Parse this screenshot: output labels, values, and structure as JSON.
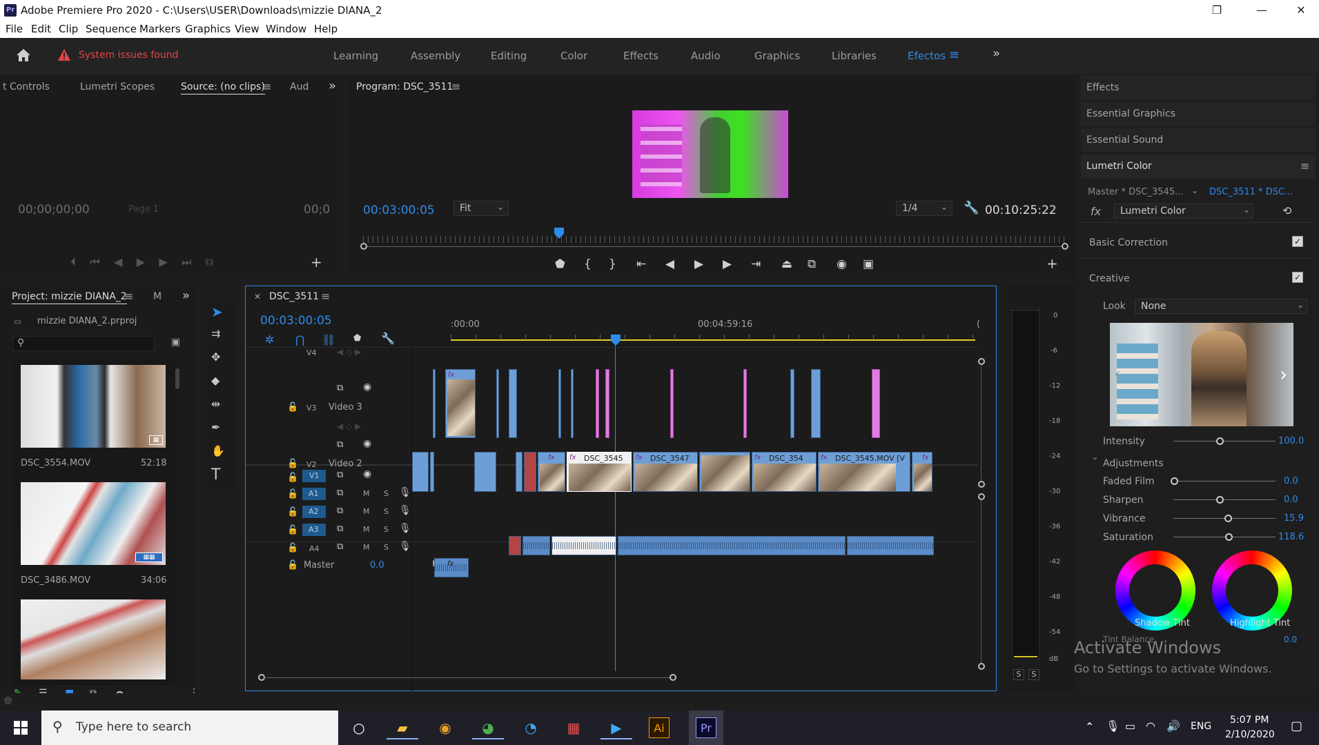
{
  "titlebar": {
    "app_icon_text": "Pr",
    "title": "Adobe Premiere Pro 2020 - C:\\Users\\USER\\Downloads\\mizzie DIANA_2",
    "minimize": "—",
    "maximize": "❐",
    "close": "✕"
  },
  "menu": [
    "File",
    "Edit",
    "Clip",
    "Sequence",
    "Markers",
    "Graphics",
    "View",
    "Window",
    "Help"
  ],
  "workspace": {
    "alert": "System issues found",
    "tabs": [
      "Learning",
      "Assembly",
      "Editing",
      "Color",
      "Effects",
      "Audio",
      "Graphics",
      "Libraries",
      "Efectos"
    ],
    "active": "Efectos"
  },
  "source_panel": {
    "tabs": [
      "t Controls",
      "Lumetri Scopes",
      "Source: (no clips)",
      "Aud"
    ],
    "timecode_left": "00;00;00;00",
    "page": "Page 1",
    "timecode_right": "00;0"
  },
  "program_panel": {
    "title": "Program: DSC_3511",
    "timecode": "00:03:00:05",
    "fit": "Fit",
    "resolution": "1/4",
    "duration": "00:10:25:22"
  },
  "project_panel": {
    "title": "Project: mizzie DIANA_2",
    "tab2": "M",
    "file": "mizzie DIANA_2.prproj",
    "items": [
      {
        "name": "DSC_3554.MOV",
        "duration": "52:18"
      },
      {
        "name": "DSC_3486.MOV",
        "duration": "34:06"
      }
    ]
  },
  "timeline": {
    "sequence": "DSC_3511",
    "timecode": "00:03:00:05",
    "ruler_start": ":00:00",
    "ruler_mid": "00:04:59:16",
    "ruler_end": "(",
    "tracks": {
      "v4": "V4",
      "v3": "V3",
      "v3_name": "Video 3",
      "v2": "V2",
      "v2_name": "Video 2",
      "v1": "V1",
      "a1": "A1",
      "a2": "A2",
      "a3": "A3",
      "a4": "A4",
      "master": "Master",
      "master_val": "0.0",
      "m": "M",
      "s": "S"
    },
    "clips_v2": [
      "DSC_3545",
      "DSC_3547",
      "DSC_354",
      "DSC_3545.MOV [V"
    ],
    "fx": "fx"
  },
  "audio_meter": {
    "scale": [
      "0",
      "-6",
      "-12",
      "-18",
      "-24",
      "-30",
      "-36",
      "-42",
      "-48",
      "-54",
      "dB"
    ],
    "solo": "S"
  },
  "right_panel": {
    "effects": "Effects",
    "essential_graphics": "Essential Graphics",
    "essential_sound": "Essential Sound",
    "lumetri": "Lumetri Color",
    "master": "Master * DSC_3545...",
    "clip_ref": "DSC_3511 * DSC...",
    "fx_label": "fx",
    "fx_value": "Lumetri Color",
    "basic": "Basic Correction",
    "creative": "Creative",
    "look_label": "Look",
    "look_value": "None",
    "intensity": {
      "label": "Intensity",
      "value": "100.0"
    },
    "adjustments": "Adjustments",
    "faded_film": {
      "label": "Faded Film",
      "value": "0.0"
    },
    "sharpen": {
      "label": "Sharpen",
      "value": "0.0"
    },
    "vibrance": {
      "label": "Vibrance",
      "value": "15.9"
    },
    "saturation": {
      "label": "Saturation",
      "value": "118.6"
    },
    "shadow_tint": "Shadow Tint",
    "highlight_tint": "Highlight Tint",
    "tint_balance": "Tint Balance",
    "tint_balance_val": "0.0"
  },
  "watermark": {
    "line1": "Activate Windows",
    "line2": "Go to Settings to activate Windows."
  },
  "taskbar": {
    "search": "Type here to search",
    "lang": "ENG",
    "time": "5:07 PM",
    "date": "2/10/2020",
    "ai": "Ai",
    "pr": "Pr"
  }
}
